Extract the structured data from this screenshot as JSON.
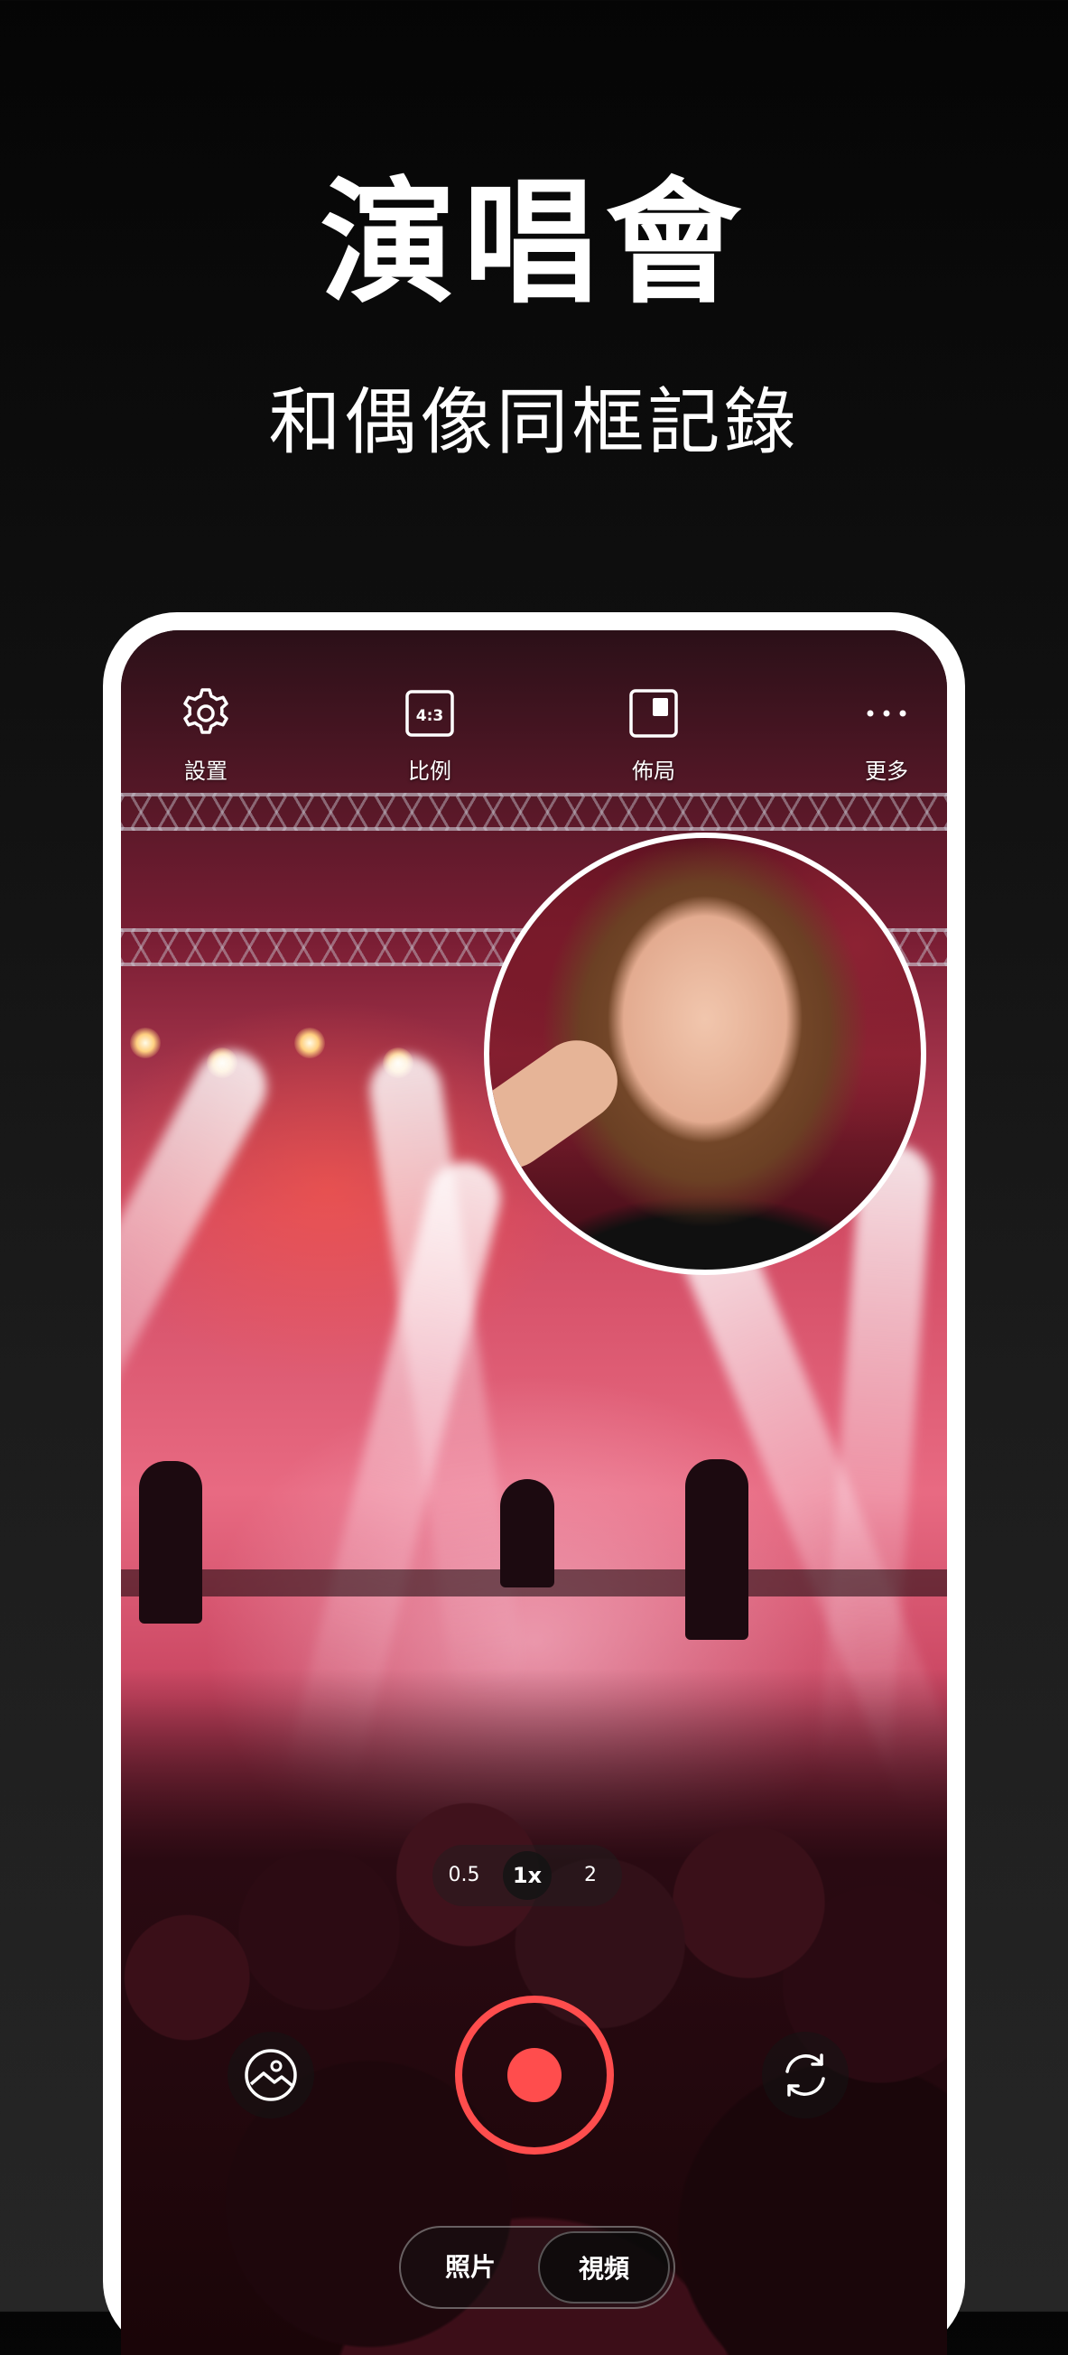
{
  "promo": {
    "title": "演唱會",
    "subtitle": "和偶像同框記錄"
  },
  "toolbar": {
    "items": [
      {
        "label": "設置",
        "icon": "gear-icon"
      },
      {
        "label": "比例",
        "icon": "aspect-ratio-icon",
        "icon_text": "4:3"
      },
      {
        "label": "佈局",
        "icon": "layout-icon"
      },
      {
        "label": "更多",
        "icon": "more-icon"
      }
    ]
  },
  "zoom": {
    "options": [
      "0.5",
      "1x",
      "2"
    ],
    "selected": "1x"
  },
  "controls": {
    "gallery_icon": "gallery-icon",
    "record_icon": "record-icon",
    "flip_icon": "flip-camera-icon",
    "record_color": "#ff4d4d"
  },
  "modes": {
    "options": [
      "照片",
      "視頻"
    ],
    "selected": "視頻"
  }
}
